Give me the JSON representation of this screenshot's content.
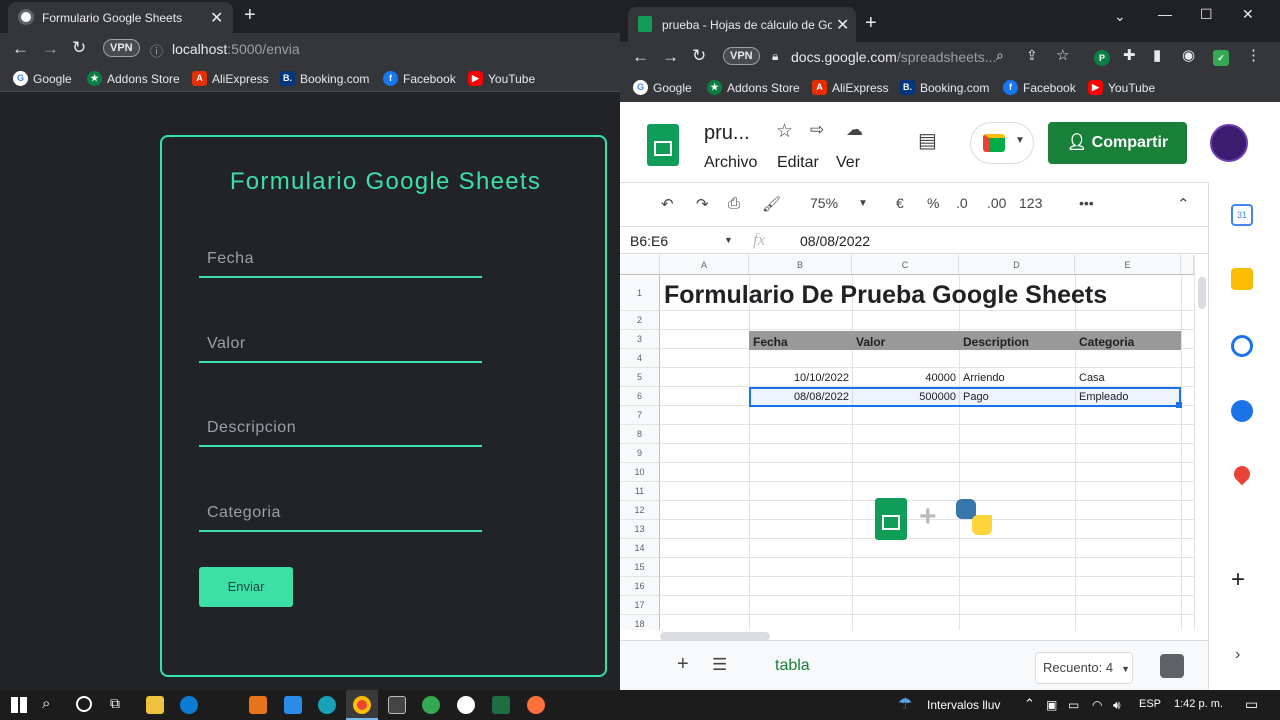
{
  "left_window": {
    "tab_title": "Formulario Google Sheets",
    "url_host": "localhost",
    "url_path": ":5000/envia",
    "vpn_label": "VPN",
    "bookmarks": [
      "Google",
      "Addons Store",
      "AliExpress",
      "Booking.com",
      "Facebook",
      "YouTube"
    ],
    "form": {
      "title": "Formulario Google Sheets",
      "fields": [
        "Fecha",
        "Valor",
        "Descripcion",
        "Categoria"
      ],
      "submit_label": "Enviar"
    },
    "accent_color": "#3ce0a7"
  },
  "right_window": {
    "tab_title": "prueba - Hojas de cálculo de Goo",
    "url_host": "docs.google.com",
    "url_path": "/spreadsheets...",
    "vpn_label": "VPN",
    "bookmarks": [
      "Google",
      "Addons Store",
      "AliExpress",
      "Booking.com",
      "Facebook",
      "YouTube"
    ],
    "doc_name": "pru...",
    "menus": [
      "Archivo",
      "Editar",
      "Ver"
    ],
    "share_label": "Compartir",
    "toolbar": {
      "zoom": "75%",
      "currency": "€",
      "percent": "%",
      "dec_less": ".0",
      "dec_more": ".00",
      "format": "123",
      "more": "•••"
    },
    "name_box": "B6:E6",
    "formula_icon": "fx",
    "formula_value": "08/08/2022",
    "columns": [
      "A",
      "B",
      "C",
      "D",
      "E"
    ],
    "rows": [
      "1",
      "2",
      "3",
      "4",
      "5",
      "6",
      "7",
      "8",
      "9",
      "10",
      "11",
      "12",
      "13",
      "14",
      "15",
      "16",
      "17",
      "18"
    ],
    "sheet_title": "Formulario De Prueba Google Sheets",
    "headers": [
      "Fecha",
      "Valor",
      "Description",
      "Categoria"
    ],
    "data_rows": [
      [
        "10/10/2022",
        "40000",
        "Arriendo",
        "Casa"
      ],
      [
        "08/08/2022",
        "500000",
        "Pago",
        "Empleado"
      ]
    ],
    "sheet_tab": "tabla",
    "status": "Recuento: 4"
  },
  "taskbar": {
    "weather": "Intervalos lluv",
    "lang": "ESP",
    "time": "1:42 p. m."
  }
}
